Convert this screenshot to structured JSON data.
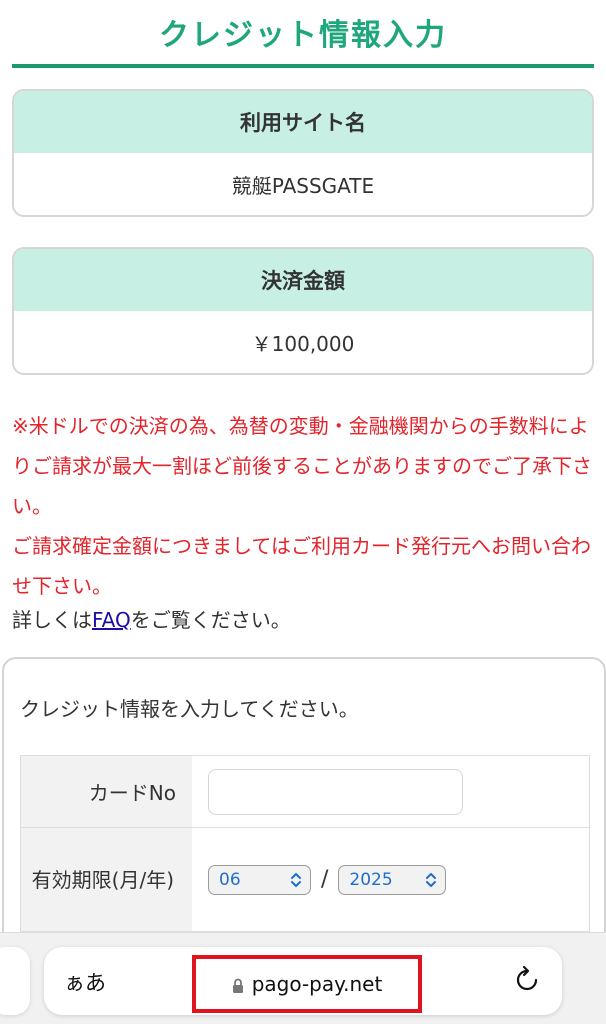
{
  "header": {
    "title": "クレジット情報入力"
  },
  "site_card": {
    "heading": "利用サイト名",
    "value": "競艇PASSGATE"
  },
  "amount_card": {
    "heading": "決済金額",
    "value": "￥100,000"
  },
  "notices": {
    "fx_warning": "※米ドルでの決済の為、為替の変動・金融機関からの手数料によりご請求が最大一割ほど前後することがありますのでご了承下さい。",
    "contact_warning": "ご請求確定金額につきましてはご利用カード発行元へお問い合わせ下さい。",
    "faq_prefix": "詳しくは",
    "faq_link": "FAQ",
    "faq_suffix": "をご覧ください。"
  },
  "credit_form": {
    "intro": "クレジット情報を入力してください。",
    "card_no_label": "カードNo",
    "card_no_value": "",
    "expiry_label": "有効期限(月/年)",
    "expiry_month": "06",
    "expiry_year": "2025",
    "separator": "/"
  },
  "browser": {
    "aa_label": "ぁあ",
    "url": "pago-pay.net"
  },
  "colors": {
    "accent_green": "#1ea67d",
    "card_header_bg": "#c7efe4",
    "warning_red": "#e3242b",
    "highlight_red": "#e0141e",
    "link_blue": "#1a0dab"
  },
  "icons": {
    "lock": "lock-icon",
    "reload": "reload-icon",
    "select_chevron": "chevron-updown-icon"
  }
}
